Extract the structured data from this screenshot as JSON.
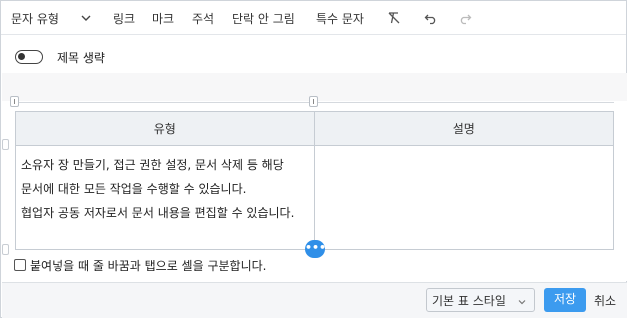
{
  "toolbar": {
    "text_type": "문자 유형",
    "link": "링크",
    "mark": "마크",
    "comment": "주석",
    "no_paragraph_wrap": "단락 안 그림",
    "special_chars": "특수 문자",
    "icons": [
      "chevron-down-icon",
      "clear-format-icon",
      "undo-icon",
      "redo-icon"
    ]
  },
  "toggle": {
    "label": "제목 생략",
    "on": false
  },
  "table": {
    "headers": [
      "유형",
      "설명"
    ],
    "rows": [
      {
        "lines": [
          "소유자  장 만들기, 접근 권한 설정, 문서 삭제 등 해당 문서에 대한 모든 작업을 수행할 수 있습니다.",
          "협업자  공동 저자로서 문서 내용을 편집할 수 있습니다."
        ],
        "second": ""
      }
    ],
    "more_button": "•••"
  },
  "paste_option": {
    "label": "붙여넣을 때 줄 바꿈과 탭으로 셀을 구분합니다.",
    "checked": false
  },
  "footer": {
    "style_select": "기본 표 스타일",
    "save": "저장",
    "cancel": "취소"
  },
  "colors": {
    "primary": "#3c9bef",
    "header_bg": "#eef1f4",
    "border": "#c6ccd3"
  }
}
